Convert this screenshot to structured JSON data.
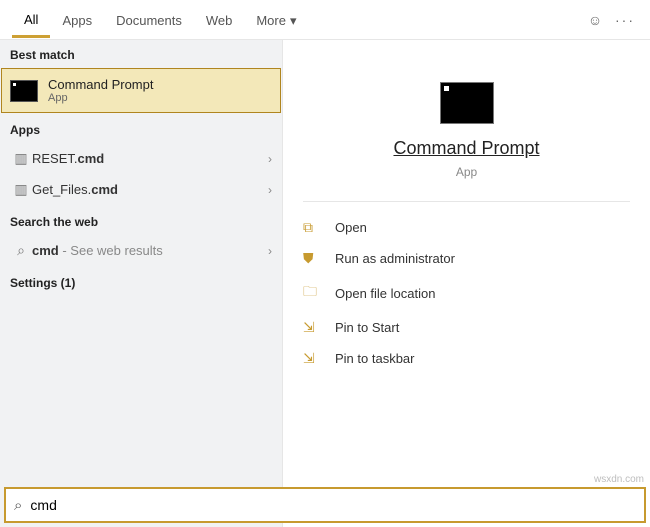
{
  "tabs": {
    "all": "All",
    "apps": "Apps",
    "documents": "Documents",
    "web": "Web",
    "more": "More"
  },
  "left": {
    "best_match_hdr": "Best match",
    "best_match_title": "Command Prompt",
    "best_match_sub": "App",
    "apps_hdr": "Apps",
    "app1_pre": "RESET.",
    "app1_bold": "cmd",
    "app2_pre": "Get_Files.",
    "app2_bold": "cmd",
    "web_hdr": "Search the web",
    "web_bold": "cmd",
    "web_sub": " - See web results",
    "settings_hdr": "Settings (1)"
  },
  "preview": {
    "title": "Command Prompt",
    "sub": "App",
    "actions": {
      "open": "Open",
      "admin": "Run as administrator",
      "location": "Open file location",
      "pin_start": "Pin to Start",
      "pin_taskbar": "Pin to taskbar"
    }
  },
  "search": {
    "value": "cmd"
  },
  "watermark": "wsxdn.com"
}
